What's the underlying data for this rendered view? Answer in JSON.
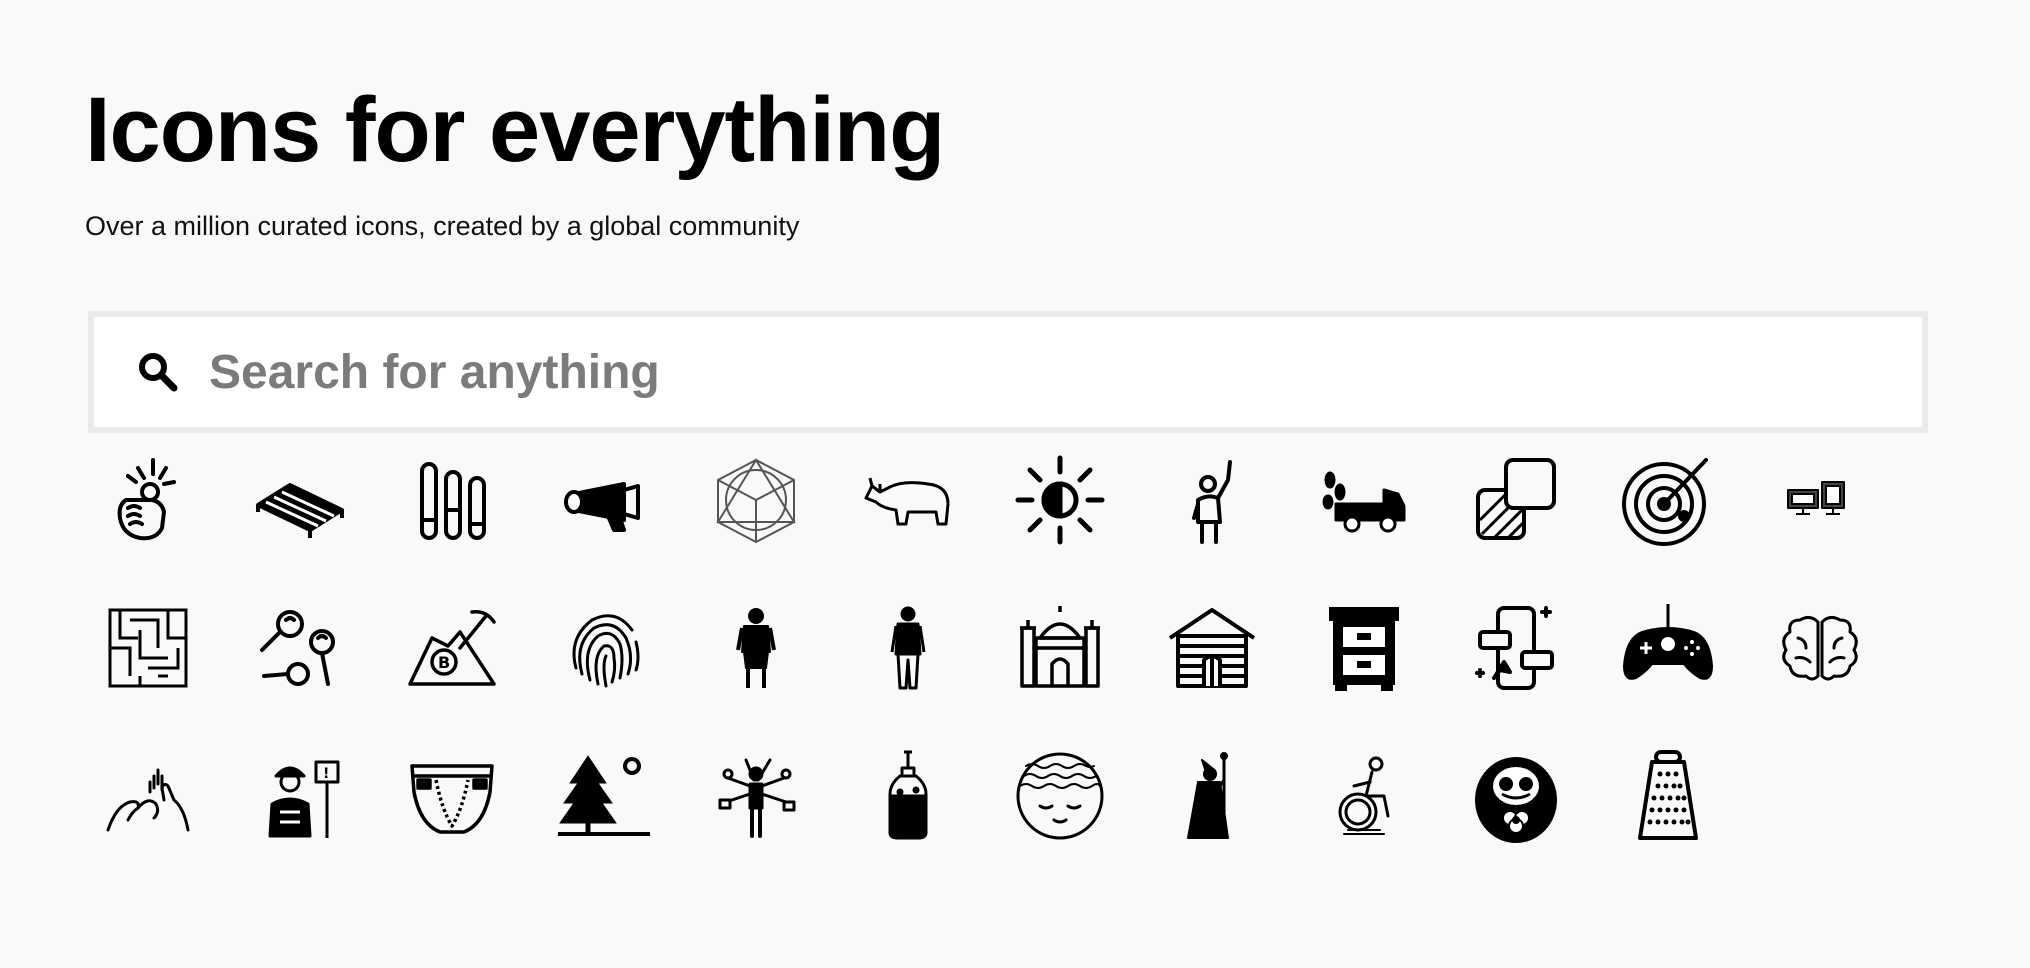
{
  "hero": {
    "title": "Icons for everything",
    "subtitle": "Over a million curated icons, created by a global community"
  },
  "search": {
    "placeholder": "Search for anything",
    "icon": "search-icon"
  },
  "icons": [
    "pointing-fist-icon",
    "bed-frame-icon",
    "test-tubes-icon",
    "megaphone-icon",
    "geometric-cube-icon",
    "rhinoceros-icon",
    "brightness-icon",
    "waving-person-icon",
    "truck-leaves-icon",
    "layers-icon",
    "radar-icon",
    "computers-icon",
    "maze-icon",
    "maracas-icon",
    "bitcoin-mining-icon",
    "fingerprint-icon",
    "man-standing-icon",
    "man-jacket-icon",
    "mosque-icon",
    "log-cabin-icon",
    "drawer-cabinet-icon",
    "mobile-chat-icon",
    "game-controller-icon",
    "brain-icon",
    "hands-icon",
    "construction-worker-icon",
    "diaper-icon",
    "tree-sun-icon",
    "multitasking-person-icon",
    "bottle-icon",
    "sleeping-moon-icon",
    "wizard-icon",
    "wheelchair-user-icon",
    "daruma-doll-icon",
    "cheese-grater-icon"
  ]
}
